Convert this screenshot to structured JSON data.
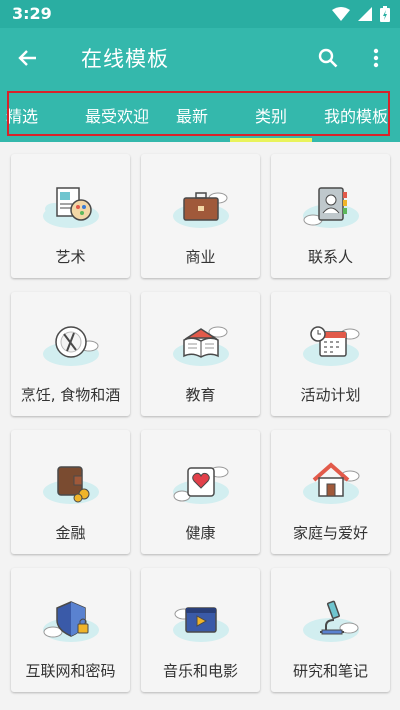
{
  "status_bar": {
    "time": "3:29",
    "icons": [
      "wifi-icon",
      "signal-icon",
      "battery-icon"
    ]
  },
  "app_bar": {
    "title": "在线模板",
    "back_icon": "arrow-left-icon",
    "search_icon": "search-icon",
    "more_icon": "more-vert-icon"
  },
  "tabs": [
    {
      "label": "精选"
    },
    {
      "label": "最受欢迎"
    },
    {
      "label": "最新"
    },
    {
      "label": "类别",
      "active": true
    },
    {
      "label": "我的模板"
    }
  ],
  "categories": [
    {
      "label": "艺术",
      "icon": "art-palette-icon"
    },
    {
      "label": "商业",
      "icon": "briefcase-icon"
    },
    {
      "label": "联系人",
      "icon": "contact-book-icon"
    },
    {
      "label": "烹饪, 食物和酒",
      "icon": "plate-cutlery-icon"
    },
    {
      "label": "教育",
      "icon": "open-book-icon"
    },
    {
      "label": "活动计划",
      "icon": "calendar-clock-icon"
    },
    {
      "label": "金融",
      "icon": "wallet-coins-icon"
    },
    {
      "label": "健康",
      "icon": "heart-frame-icon"
    },
    {
      "label": "家庭与爱好",
      "icon": "house-icon"
    },
    {
      "label": "互联网和密码",
      "icon": "shield-lock-icon"
    },
    {
      "label": "音乐和电影",
      "icon": "film-play-icon"
    },
    {
      "label": "研究和笔记",
      "icon": "microscope-icon"
    }
  ],
  "colors": {
    "primary": "#34b8ac",
    "status_bar": "#2aaea2",
    "tab_indicator": "#e9f35b",
    "highlight_box": "#d8232a"
  }
}
